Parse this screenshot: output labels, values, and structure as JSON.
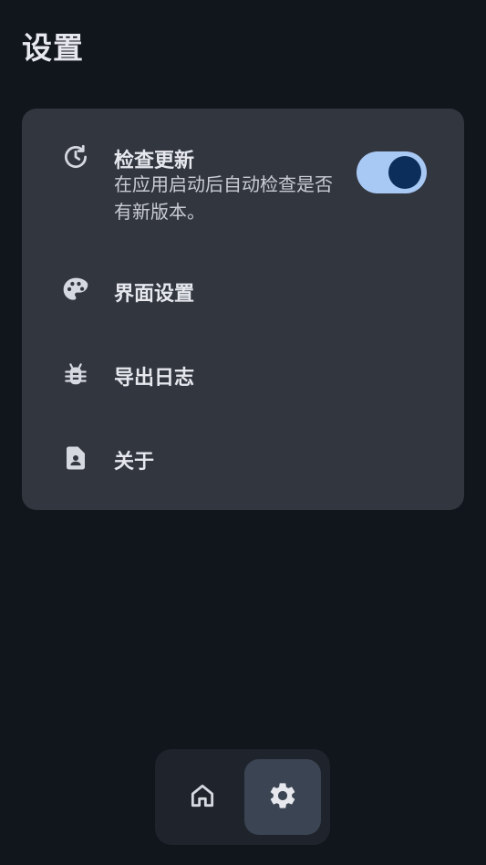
{
  "page": {
    "title": "设置"
  },
  "settings": {
    "items": [
      {
        "id": "check-updates",
        "label": "检查更新",
        "description": "在应用启动后自动检查是否有新版本。",
        "icon": "history-icon",
        "toggle_on": true
      },
      {
        "id": "ui-settings",
        "label": "界面设置",
        "icon": "palette-icon"
      },
      {
        "id": "export-logs",
        "label": "导出日志",
        "icon": "bug-icon"
      },
      {
        "id": "about",
        "label": "关于",
        "icon": "contact-page-icon"
      }
    ]
  },
  "nav": {
    "items": [
      {
        "id": "home",
        "icon": "home-icon",
        "selected": false
      },
      {
        "id": "settings",
        "icon": "gear-icon",
        "selected": true
      }
    ]
  },
  "colors": {
    "background": "#11151c",
    "card": "#32363f",
    "toggle_track": "#a9c9f5",
    "toggle_thumb": "#0b2f5a",
    "nav_bar": "#1f242c",
    "nav_selected": "#3b4452"
  }
}
